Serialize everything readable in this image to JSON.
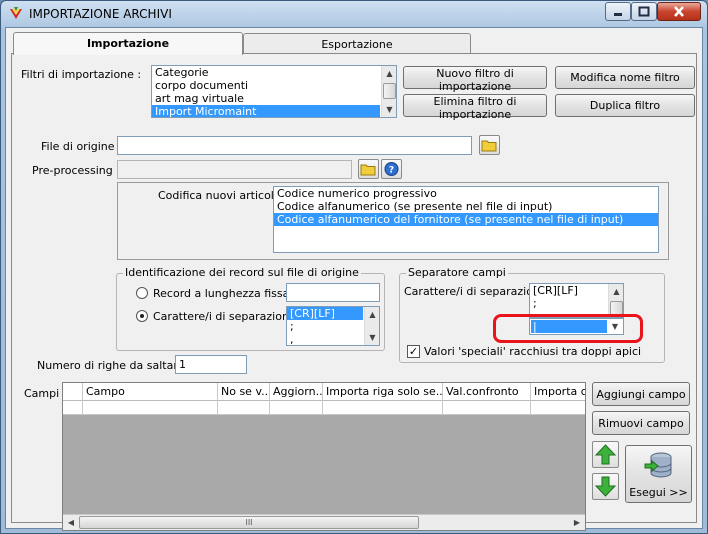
{
  "window": {
    "title": "IMPORTAZIONE ARCHIVI"
  },
  "tabs": [
    {
      "label": "Importazione",
      "active": true
    },
    {
      "label": "Esportazione",
      "active": false
    }
  ],
  "filters": {
    "label": "Filtri di importazione :",
    "items": [
      "Categorie",
      "corpo documenti",
      "art mag virtuale",
      "Import Micromaint"
    ],
    "selected_index": 3
  },
  "buttons": {
    "new_filter": "Nuovo filtro di importazione",
    "rename_filter": "Modifica nome filtro",
    "delete_filter": "Elimina filtro di importazione",
    "duplicate_filter": "Duplica filtro",
    "add_field": "Aggiungi campo",
    "remove_field": "Rimuovi campo",
    "execute": "Esegui >>"
  },
  "file_origin": {
    "label": "File di origine :",
    "value": ""
  },
  "preprocessing": {
    "label": "Pre-processing :",
    "value": ""
  },
  "encoding": {
    "label": "Codifica nuovi articoli :",
    "items": [
      "Codice numerico progressivo",
      "Codice alfanumerico (se presente nel file di input)",
      "Codice alfanumerico del fornitore (se presente nel file di input)"
    ],
    "selected_index": 2
  },
  "record_id": {
    "title": "Identificazione dei record sul file di origine",
    "option_fixed": "Record a lunghezza fissa",
    "option_sep": "Carattere/i di separazione",
    "selected": "option_sep",
    "fixed_value": "",
    "sep_items": [
      "[CR][LF]",
      ";",
      ","
    ],
    "sep_selected_index": 0
  },
  "field_sep": {
    "title": "Separatore campi",
    "label": "Carattere/i di separazione",
    "items": [
      "[CR][LF]",
      ";",
      ",",
      "|"
    ],
    "combo_value": "|",
    "quoted_label": "Valori 'speciali' racchiusi tra doppi apici",
    "quoted_checked": true
  },
  "skip_rows": {
    "label": "Numero di righe da saltare :",
    "value": "1"
  },
  "fields_grid": {
    "label": "Campi :",
    "columns": [
      "Campo",
      "No se v...",
      "Aggiorn...",
      "Importa riga solo se...",
      "Val.confronto",
      "Importa cam"
    ],
    "scroll_thumb_text": "III"
  },
  "colors": {
    "selection": "#3399ff",
    "highlight": "#e8141a",
    "grid_body": "#a9a9a9"
  },
  "icons": [
    "app-icon",
    "minimize-icon",
    "maximize-icon",
    "close-icon",
    "folder-icon",
    "help-icon",
    "arrow-up-icon",
    "arrow-down-icon",
    "database-import-icon"
  ]
}
